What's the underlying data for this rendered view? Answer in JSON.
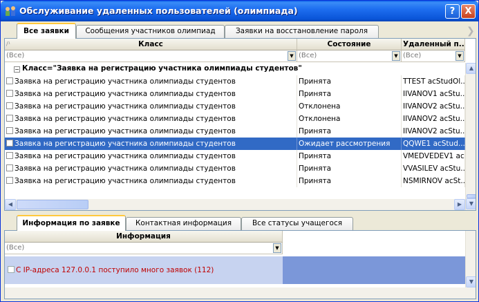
{
  "window": {
    "title": "Обслуживание удаленных пользователей (олимпиада)",
    "help_label": "?",
    "close_label": "X"
  },
  "top_tabs": [
    {
      "label": "Все заявки"
    },
    {
      "label": "Сообщения участников олимпиад"
    },
    {
      "label": "Заявки на восстановление пароля"
    }
  ],
  "top_tabs_scroll_label": "❯",
  "grid": {
    "sort_indicator": "/¹",
    "columns": [
      {
        "label": "Класс",
        "filter": "(Все)"
      },
      {
        "label": "Состояние",
        "filter": "(Все)"
      },
      {
        "label": "Удаленный п...",
        "filter": "(Все)"
      }
    ],
    "group_label": "Класс=\"Заявка на регистрацию участника олимпиады студентов\"",
    "rows": [
      {
        "klass": "Заявка на регистрацию участника олимпиады студентов",
        "state": "Принята",
        "user": "TTEST acStudOl..."
      },
      {
        "klass": "Заявка на регистрацию участника олимпиады студентов",
        "state": "Принята",
        "user": "IIVANOV1 acStu..."
      },
      {
        "klass": "Заявка на регистрацию участника олимпиады студентов",
        "state": "Отклонена",
        "user": "IIVANOV2 acStu..."
      },
      {
        "klass": "Заявка на регистрацию участника олимпиады студентов",
        "state": "Отклонена",
        "user": "IIVANOV2 acStu..."
      },
      {
        "klass": "Заявка на регистрацию участника олимпиады студентов",
        "state": "Принята",
        "user": "IIVANOV2 acStu..."
      },
      {
        "klass": "Заявка на регистрацию участника олимпиады студентов",
        "state": "Ожидает рассмотрения",
        "user": "QQWE1 acStud..."
      },
      {
        "klass": "Заявка на регистрацию участника олимпиады студентов",
        "state": "Принята",
        "user": "VMEDVEDEV1 ac..."
      },
      {
        "klass": "Заявка на регистрацию участника олимпиады студентов",
        "state": "Принята",
        "user": "VVASILEV acStu..."
      },
      {
        "klass": "Заявка на регистрацию участника олимпиады студентов",
        "state": "Принята",
        "user": "NSMIRNOV acSt..."
      }
    ],
    "selected_row": 5
  },
  "bottom_tabs": [
    {
      "label": "Информация по заявке"
    },
    {
      "label": "Контактная информация"
    },
    {
      "label": "Все статусы учащегося"
    }
  ],
  "info_grid": {
    "column_label": "Информация",
    "filter": "(Все)",
    "rows": [
      {
        "text": "С IP-адреса 127.0.0.1 поступило много заявок (112)"
      }
    ]
  },
  "colors": {
    "selection": "#316ac5",
    "info_row_bg": "#c7d3f0",
    "info_row_right_bg": "#7b97d9",
    "info_text": "#c00000",
    "active_tab_accent": "#ffc83c"
  }
}
